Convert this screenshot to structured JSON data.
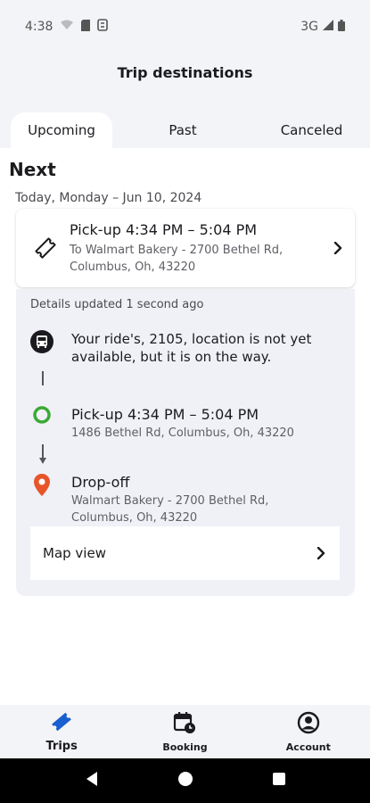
{
  "status_bar": {
    "time": "4:38",
    "network": "3G"
  },
  "header": {
    "title": "Trip destinations"
  },
  "tabs": [
    {
      "label": "Upcoming",
      "active": true
    },
    {
      "label": "Past",
      "active": false
    },
    {
      "label": "Canceled",
      "active": false
    }
  ],
  "next_section": {
    "title": "Next",
    "date": "Today, Monday – Jun 10, 2024"
  },
  "trip_card": {
    "title": "Pick-up 4:34 PM – 5:04 PM",
    "destination_line1": "To Walmart Bakery - 2700 Bethel Rd,",
    "destination_line2": "Columbus, Oh, 43220",
    "icon": "ticket-icon"
  },
  "details": {
    "updated": "Details updated 1 second ago",
    "bus_message": "Your ride's, 2105, location is not yet available, but it is on the way.",
    "pickup": {
      "title": "Pick-up 4:34 PM – 5:04 PM",
      "address": "1486 Bethel Rd, Columbus, Oh, 43220"
    },
    "dropoff": {
      "title": "Drop-off",
      "address_line1": "Walmart Bakery - 2700 Bethel Rd,",
      "address_line2": "Columbus, Oh, 43220"
    },
    "map_view_label": "Map view"
  },
  "bottom_nav": [
    {
      "label": "Trips",
      "icon": "ticket-icon",
      "active": true
    },
    {
      "label": "Booking",
      "icon": "calendar-clock-icon",
      "active": false
    },
    {
      "label": "Account",
      "icon": "account-icon",
      "active": false
    }
  ],
  "colors": {
    "accent_blue": "#1a5fd1",
    "pickup_green": "#3aa935",
    "dropoff_orange": "#e8542a",
    "text_primary": "#1b1b1f",
    "background": "#f3f4f7"
  }
}
